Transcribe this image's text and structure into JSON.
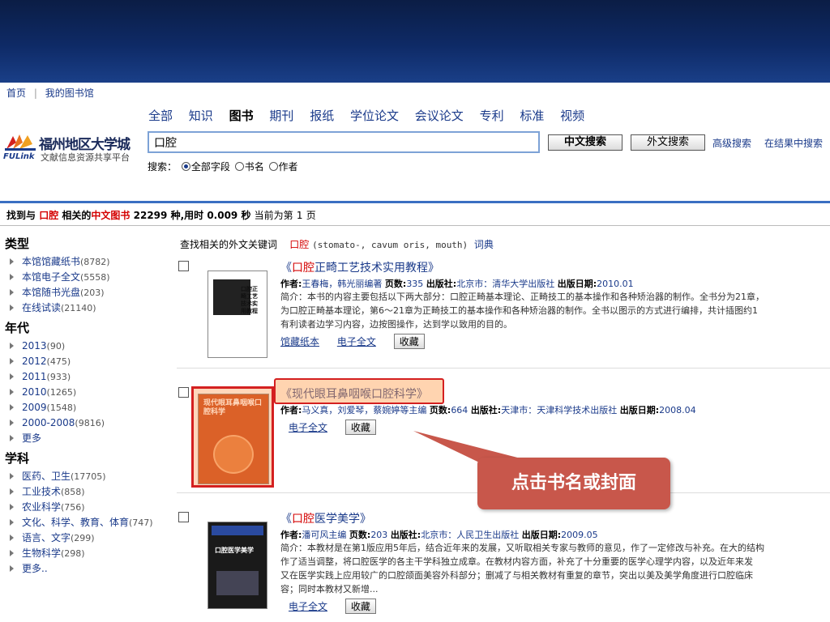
{
  "topnav": {
    "home": "首页",
    "separator": "|",
    "my_library": "我的图书馆"
  },
  "logo": {
    "name": "福州地区大学城",
    "en": "FULink",
    "subtitle": "文献信息资源共享平台"
  },
  "category_tabs": [
    "全部",
    "知识",
    "图书",
    "期刊",
    "报纸",
    "学位论文",
    "会议论文",
    "专利",
    "标准",
    "视频"
  ],
  "active_tab": "图书",
  "search": {
    "query": "口腔",
    "btn_chinese": "中文搜索",
    "btn_foreign": "外文搜索",
    "advanced": "高级搜索",
    "in_results": "在结果中搜索",
    "mode_label": "搜索：",
    "modes": [
      "全部字段",
      "书名",
      "作者"
    ]
  },
  "status": {
    "prefix": "找到与",
    "keyword": "口腔",
    "mid": "相关的",
    "type": "中文图书",
    "count": "22299",
    "unit": "种,用时",
    "time": "0.009",
    "sec": "秒",
    "page_text": "当前为第",
    "page": "1",
    "page_unit": "页"
  },
  "facets": [
    {
      "title": "类型",
      "items": [
        {
          "label": "本馆馆藏纸书",
          "count": "(8782)"
        },
        {
          "label": "本馆电子全文",
          "count": "(5558)"
        },
        {
          "label": "本馆随书光盘",
          "count": "(203)"
        },
        {
          "label": "在线试读",
          "count": "(21140)"
        }
      ]
    },
    {
      "title": "年代",
      "items": [
        {
          "label": "2013",
          "count": "(90)"
        },
        {
          "label": "2012",
          "count": "(475)"
        },
        {
          "label": "2011",
          "count": "(933)"
        },
        {
          "label": "2010",
          "count": "(1265)"
        },
        {
          "label": "2009",
          "count": "(1548)"
        },
        {
          "label": "2000-2008",
          "count": "(9816)"
        },
        {
          "label": "更多",
          "count": ""
        }
      ]
    },
    {
      "title": "学科",
      "items": [
        {
          "label": "医药、卫生",
          "count": "(17705)"
        },
        {
          "label": "工业技术",
          "count": "(858)"
        },
        {
          "label": "农业科学",
          "count": "(756)"
        },
        {
          "label": "文化、科学、教育、体育",
          "count": "(747)"
        },
        {
          "label": "语言、文字",
          "count": "(299)"
        },
        {
          "label": "生物科学",
          "count": "(298)"
        },
        {
          "label": "更多..",
          "count": ""
        }
      ]
    }
  ],
  "related": {
    "label": "查找相关的外文关键词",
    "keyword": "口腔",
    "terms": "(stomato-, cavum oris, mouth)",
    "dict": "词典"
  },
  "results": [
    {
      "title_pre": "《",
      "title_kw": "口腔",
      "title_post": "正畸工艺技术实用教程》",
      "author_label": "作者:",
      "author": "王春梅，韩光丽编著",
      "pages_label": "页数:",
      "pages": "335",
      "publisher_label": "出版社:",
      "publisher": "北京市：清华大学出版社",
      "date_label": "出版日期:",
      "date": "2010.01",
      "abstract": [
        "简介：本书的内容主要包括以下两大部分：口腔正畸基本理论、正畸技工的基本操作和各种矫治器的制作。全书分为21章，",
        "为口腔正畸基本理论，第6～21章为正畸技工的基本操作和各种矫治器的制作。全书以图示的方式进行编排，共计插图约1",
        "有利读者边学习内容，边按图操作，达到学以致用的目的。"
      ],
      "links": [
        "馆藏纸本",
        "电子全文"
      ],
      "fav": "收藏",
      "cover_text": "口腔正畸工艺技术实用教程"
    },
    {
      "title_pre": "《",
      "title_kw": "",
      "title_post": "现代眼耳鼻咽喉口腔科学》",
      "author_label": "作者:",
      "author": "马义真，刘爱琴，蔡婉婷等主编",
      "pages_label": "页数:",
      "pages": "664",
      "publisher_label": "出版社:",
      "publisher": "天津市：天津科学技术出版社",
      "date_label": "出版日期:",
      "date": "2008.04",
      "abstract": [],
      "links": [
        "电子全文"
      ],
      "fav": "收藏",
      "cover_text": "现代眼耳鼻咽喉口腔科学"
    },
    {
      "title_pre": "《",
      "title_kw": "口腔",
      "title_post": "医学美学》",
      "author_label": "作者:",
      "author": "潘可风主编",
      "pages_label": "页数:",
      "pages": "203",
      "publisher_label": "出版社:",
      "publisher": "北京市：人民卫生出版社",
      "date_label": "出版日期:",
      "date": "2009.05",
      "abstract": [
        "简介：本教材是在第1版应用5年后，结合近年来的发展，又听取相关专家与教师的意见，作了一定修改与补充。在大的结构",
        "作了适当调整，将口腔医学的各主干学科独立成章。在教材内容方面，补充了十分重要的医学心理学内容，以及近年来发",
        "又在医学实践上应用较广的口腔颌面美容外科部分；删减了与相关教材有重复的章节，突出以美及美学角度进行口腔临床",
        "容；同时本教材又新增..."
      ],
      "links": [
        "电子全文"
      ],
      "fav": "收藏",
      "cover_text": "口腔医学美学"
    }
  ],
  "callout": "点击书名或封面",
  "colors": {
    "banner": "#0e2a66",
    "link": "#1a3a8a",
    "highlight": "#d40000",
    "callout": "#c8574b"
  }
}
